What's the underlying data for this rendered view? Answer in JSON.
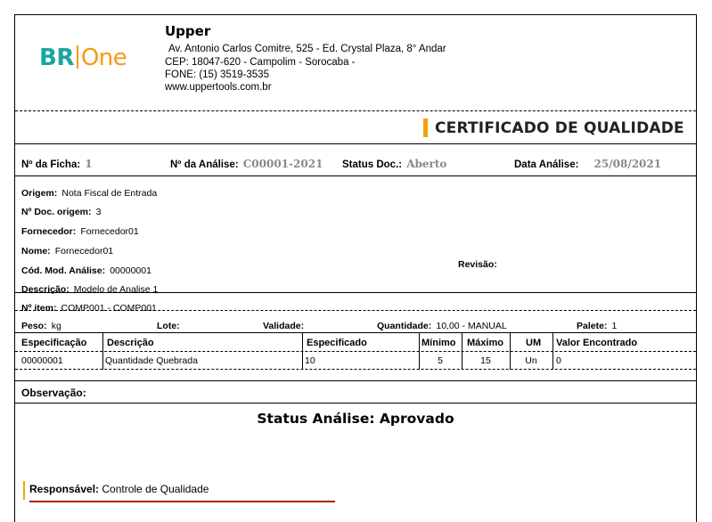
{
  "logo": {
    "part1": "BR",
    "part2": "One"
  },
  "company": {
    "name": "Upper",
    "address": "Av. Antonio Carlos Comitre, 525 - Ed. Crystal Plaza, 8° Andar",
    "cep": "CEP: 18047-620 - Campolim - Sorocaba -",
    "fone": "FONE: (15) 3519-3535",
    "site": "www.uppertools.com.br"
  },
  "title": "CERTIFICADO DE QUALIDADE",
  "header_row": {
    "ficha_label": "Nº da Ficha:",
    "ficha_value": "1",
    "analise_label": "Nº da Análise:",
    "analise_value": "C00001-2021",
    "status_label": "Status Doc.:",
    "status_value": "Aberto",
    "data_label": "Data Análise:",
    "data_value": "25/08/2021"
  },
  "info": {
    "origem_label": "Origem:",
    "origem_value": "Nota Fiscal de Entrada",
    "doc_label": "Nº Doc. origem:",
    "doc_value": "3",
    "fornecedor_label": "Fornecedor:",
    "fornecedor_value": "Fornecedor01",
    "nome_label": "Nome:",
    "nome_value": "Fornecedor01",
    "cod_label": "Cód. Mod. Análise:",
    "cod_value": "00000001",
    "descricao_label": "Descrição:",
    "descricao_value": "Modelo de Analise 1",
    "revisao_label": "Revisão:"
  },
  "item": {
    "item_label": "Nº item:",
    "item_value": "COMP001 - COMP001",
    "peso_label": "Peso:",
    "peso_value": "kg",
    "lote_label": "Lote:",
    "validade_label": "Validade:",
    "quantidade_label": "Quantidade:",
    "quantidade_value": "10,00 - MANUAL",
    "palete_label": "Palete:",
    "palete_value": "1"
  },
  "table": {
    "headers": [
      "Especificação",
      "Descrição",
      "Especificado",
      "Mínimo",
      "Máximo",
      "UM",
      "Valor Encontrado"
    ],
    "rows": [
      [
        "00000001",
        "Quantidade Quebrada",
        "10",
        "5",
        "15",
        "Un",
        "0"
      ]
    ]
  },
  "observacao_label": "Observação:",
  "status_analise": "Status Análise:  Aprovado",
  "responsavel": {
    "label": "Responsável:",
    "value": "Controle de Qualidade"
  },
  "colors": {
    "accent_orange": "#f3a40c",
    "accent_teal": "#1aa5a0",
    "red_line": "#b01c1c",
    "grey_value": "#888888"
  }
}
